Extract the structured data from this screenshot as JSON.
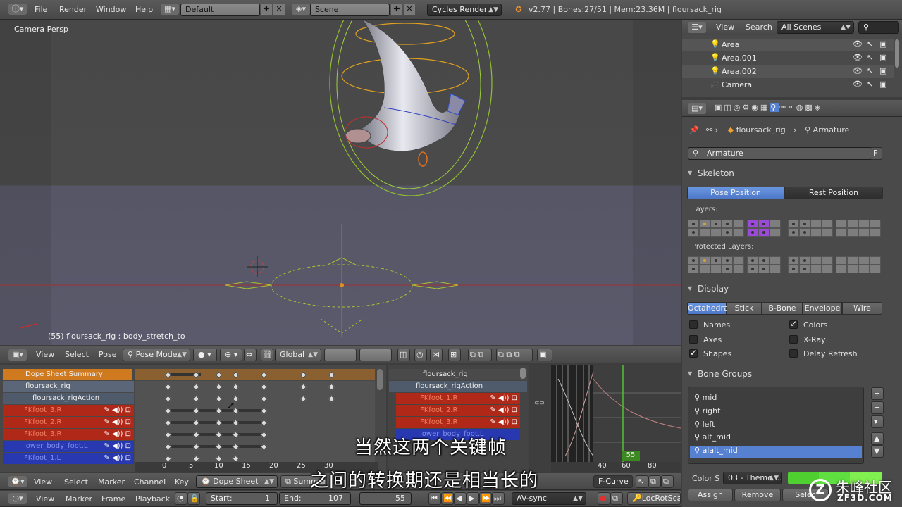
{
  "topbar": {
    "menus": [
      "File",
      "Render",
      "Window",
      "Help"
    ],
    "layout": "Default",
    "scene": "Scene",
    "engine": "Cycles Render",
    "stats": "v2.77 | Bones:27/51 | Mem:23.36M | floursack_rig"
  },
  "viewport": {
    "label": "Camera Persp",
    "status": "(55) floursack_rig : body_stretch_to"
  },
  "viewport_header": {
    "menus": [
      "View",
      "Select",
      "Pose"
    ],
    "mode": "Pose Mode",
    "orientation": "Global"
  },
  "outliner": {
    "menus": [
      "View",
      "Search"
    ],
    "filter": "All Scenes",
    "items": [
      "Area",
      "Area.001",
      "Area.002",
      "Camera"
    ]
  },
  "properties": {
    "breadcrumb_obj": "floursack_rig",
    "breadcrumb_data": "Armature",
    "datablock": "Armature",
    "datablock_flag": "F",
    "skeleton": {
      "title": "Skeleton",
      "pose_position": "Pose Position",
      "rest_position": "Rest Position",
      "layers_label": "Layers:",
      "protected_label": "Protected Layers:"
    },
    "display": {
      "title": "Display",
      "modes": [
        "Octahedral",
        "Stick",
        "B-Bone",
        "Envelope",
        "Wire"
      ],
      "names": "Names",
      "colors": "Colors",
      "axes": "Axes",
      "xray": "X-Ray",
      "shapes": "Shapes",
      "delay_refresh": "Delay Refresh"
    },
    "bone_groups": {
      "title": "Bone Groups",
      "items": [
        "mid",
        "right",
        "left",
        "alt_mid",
        "alalt_mid"
      ],
      "color_set_label": "Color S",
      "color_set": "03 - Theme ...",
      "assign": "Assign",
      "remove": "Remove",
      "select": "Selec"
    }
  },
  "dopesheet": {
    "summary": "Dope Sheet Summary",
    "object": "floursack_rig",
    "action": "floursack_rigAction",
    "channels": [
      "FKfoot_3.R",
      "FKfoot_2.R",
      "FKfoot_3.R",
      "lower_body_foot.L",
      "FKfoot_1.L"
    ],
    "ruler": [
      "0",
      "5",
      "10",
      "15",
      "20",
      "25",
      "30"
    ],
    "header_menus": [
      "View",
      "Select",
      "Marker",
      "Channel",
      "Key"
    ],
    "mode": "Dope Sheet",
    "summary_btn": "Summary"
  },
  "nla": {
    "object": "floursack_rig",
    "action": "floursack_rigAction",
    "channels": [
      "FKfoot_1.R",
      "FKfoot_2.R",
      "FKfoot_3.R",
      "lower_body_foot.L"
    ]
  },
  "graph": {
    "ruler": [
      "40",
      "60",
      "80"
    ],
    "frame": "55",
    "mode": "F-Curve"
  },
  "timeline": {
    "menus": [
      "View",
      "Marker",
      "Frame",
      "Playback"
    ],
    "start_label": "Start:",
    "start": "1",
    "end_label": "End:",
    "end": "107",
    "current": "55",
    "sync": "AV-sync",
    "keying": "LocRotScal"
  },
  "subtitles": {
    "line1": "当然这两个关键帧",
    "line2": "之间的转换期还是相当长的"
  },
  "watermark": {
    "brand": "朱峰社区",
    "url": "ZF3D.COM"
  },
  "colors": {
    "viewport_top": "#4a4a4a",
    "viewport_bottom": "#5a5a6a",
    "accent_blue": "#5680d0",
    "summary_orange": "#d07a20",
    "channel_red": "#b02818",
    "channel_blue": "#2838b0",
    "purple_layer": "#9b4ad8"
  }
}
